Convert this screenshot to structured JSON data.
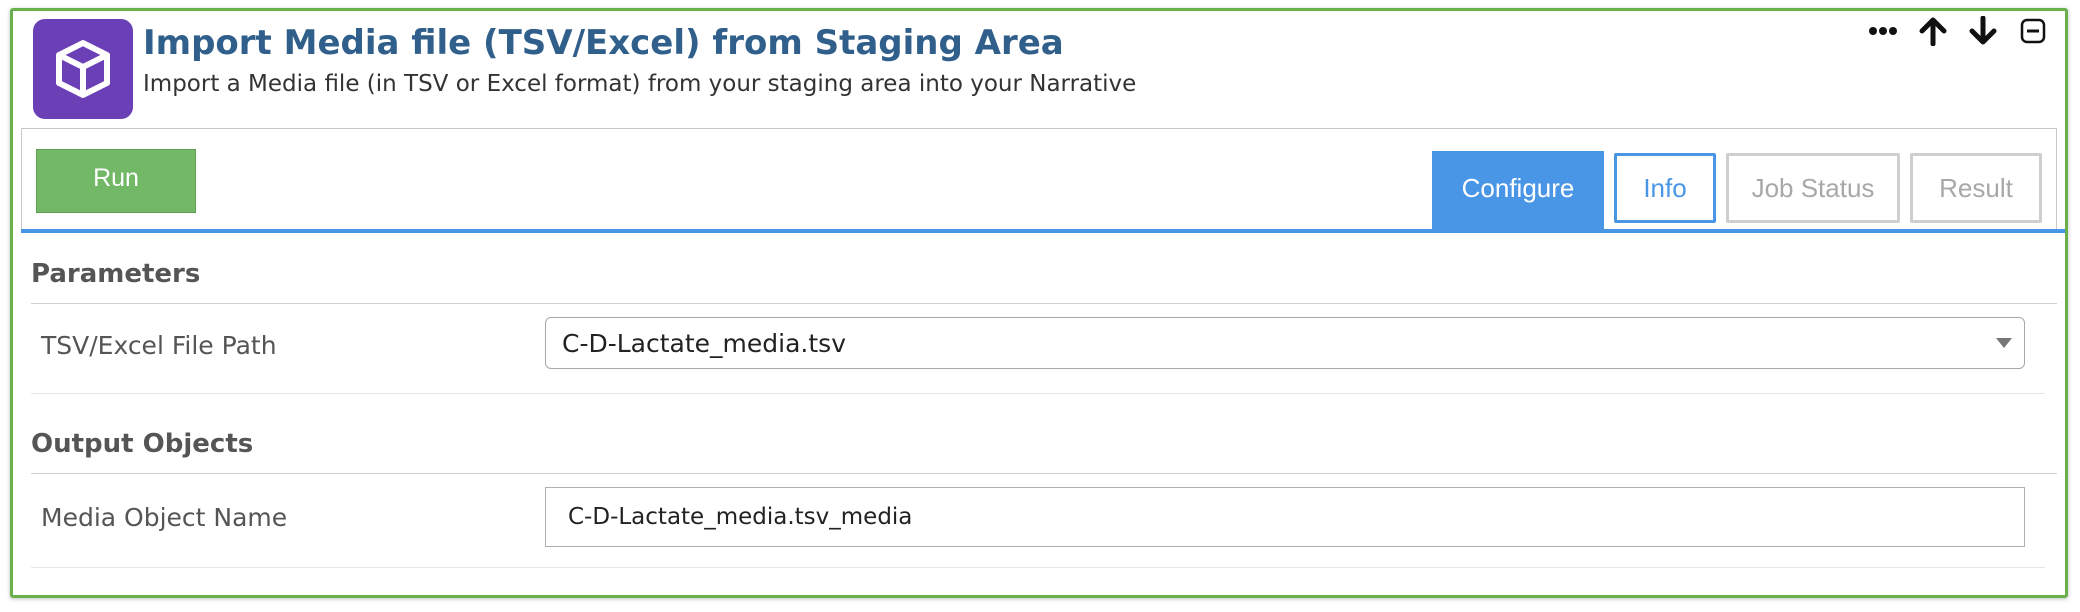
{
  "header": {
    "title": "Import Media file (TSV/Excel) from Staging Area",
    "subtitle": "Import a Media file (in TSV or Excel format) from your staging area into your Narrative",
    "app_icon": "cube-icon",
    "controls": [
      "more-options-icon",
      "arrow-up-icon",
      "arrow-down-icon",
      "collapse-icon"
    ]
  },
  "toolbar": {
    "run_label": "Run",
    "tabs": [
      {
        "label": "Configure",
        "state": "active"
      },
      {
        "label": "Info",
        "state": "enabled"
      },
      {
        "label": "Job Status",
        "state": "disabled"
      },
      {
        "label": "Result",
        "state": "disabled"
      }
    ]
  },
  "parameters": {
    "section_title": "Parameters",
    "file_path": {
      "label": "TSV/Excel File Path",
      "value": "C-D-Lactate_media.tsv"
    }
  },
  "outputs": {
    "section_title": "Output Objects",
    "media_name": {
      "label": "Media Object Name",
      "value": "C-D-Lactate_media.tsv_media"
    }
  },
  "colors": {
    "cell_border": "#6ab04c",
    "title": "#2f5f8a",
    "app_icon_bg": "#6b3fb5",
    "run_button": "#72b866",
    "accent_blue": "#4a96e6",
    "disabled_tab": "#a8a8a8"
  }
}
